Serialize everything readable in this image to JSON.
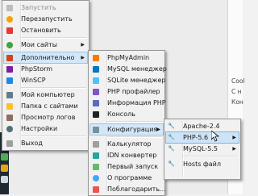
{
  "right_window": {
    "lines": [
      "Cool",
      "С н",
      "Кон"
    ]
  },
  "main_menu": {
    "items": [
      {
        "label": "Запустить",
        "icon": "play-icon",
        "disabled": true
      },
      {
        "label": "Перезапустить",
        "icon": "restart-icon"
      },
      {
        "label": "Остановить",
        "icon": "stop-flag-icon"
      },
      {
        "label": "Мои сайты",
        "icon": "globe-icon",
        "submenu": true
      },
      {
        "label": "Дополнительно",
        "icon": "tools-icon",
        "submenu": true,
        "highlighted": true
      },
      {
        "label": "PhpStorm",
        "icon": "phpstorm-icon"
      },
      {
        "label": "WinSCP",
        "icon": "winscp-icon"
      },
      {
        "label": "Мой компьютер",
        "icon": "computer-icon"
      },
      {
        "label": "Папка с сайтами",
        "icon": "folder-icon"
      },
      {
        "label": "Просмотр логов",
        "icon": "logs-icon"
      },
      {
        "label": "Настройки",
        "icon": "settings-icon"
      },
      {
        "label": "Выход",
        "icon": "exit-icon"
      }
    ]
  },
  "sub_menu": {
    "items": [
      {
        "label": "PhpMyAdmin",
        "icon": "phpmyadmin-icon"
      },
      {
        "label": "MySQL менеджер",
        "icon": "mysql-icon"
      },
      {
        "label": "SQLite менеджер",
        "icon": "sqlite-icon"
      },
      {
        "label": "PHP профайлер",
        "icon": "profiler-icon"
      },
      {
        "label": "Информация PHP",
        "icon": "info-icon"
      },
      {
        "label": "Консоль",
        "icon": "console-icon"
      },
      {
        "label": "Конфигурация",
        "icon": "config-icon",
        "submenu": true,
        "highlighted": true
      },
      {
        "label": "Калькулятор",
        "icon": "calculator-icon"
      },
      {
        "label": "IDN конвертер",
        "icon": "idn-icon"
      },
      {
        "label": "Первый запуск",
        "icon": "first-run-icon"
      },
      {
        "label": "О программе",
        "icon": "about-icon"
      },
      {
        "label": "Поблагодарить...",
        "icon": "thanks-icon"
      }
    ]
  },
  "config_menu": {
    "items": [
      {
        "label": "Apache-2.4",
        "icon": "wrench-icon"
      },
      {
        "label": "PHP-5.6",
        "icon": "wrench-icon",
        "submenu": true,
        "highlighted": true
      },
      {
        "label": "MySQL-5.5",
        "icon": "wrench-icon",
        "submenu": true
      },
      {
        "label": "Hosts файл",
        "icon": "wrench-icon"
      }
    ]
  },
  "colors": {
    "highlight": "#d3e7f8",
    "highlight_border": "#9cc4ea",
    "menu_bg": "#f1f1f1",
    "disabled_text": "#8d8d8d"
  }
}
